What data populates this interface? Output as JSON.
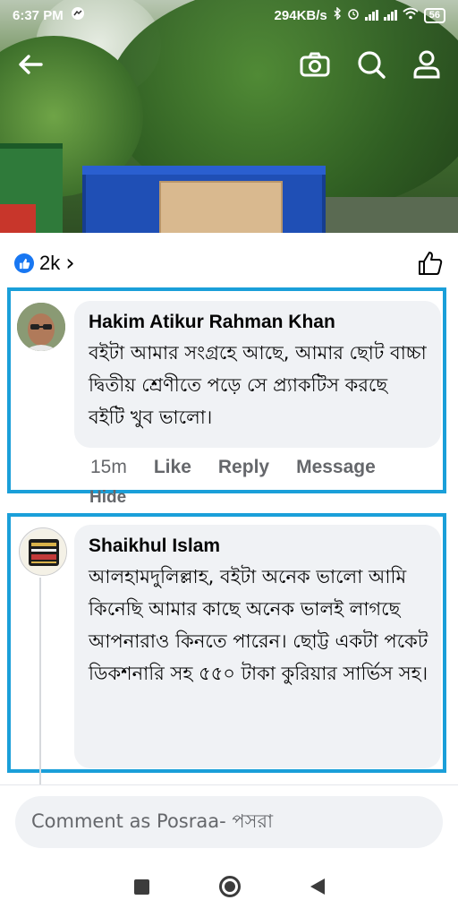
{
  "status_bar": {
    "time": "6:37 PM",
    "speed": "294KB/s",
    "battery": "56"
  },
  "toolbar": {
    "icons": [
      "back-arrow-icon",
      "camera-icon",
      "search-icon",
      "profile-icon"
    ]
  },
  "reactions": {
    "count": "2k",
    "chevron": "›"
  },
  "comments": [
    {
      "author": "Hakim Atikur Rahman Khan",
      "text": "বইটা আমার সংগ্রহে আছে, আমার ছোট বাচ্চা দ্বিতীয় শ্রেণীতে পড়ে সে প্র্যাকটিস করছে বইটি খুব ভালো।",
      "time": "15m",
      "like_label": "Like",
      "reply_label": "Reply",
      "message_label": "Message",
      "hide_label": "Hide"
    },
    {
      "author": "Shaikhul Islam",
      "text": "আলহামদুলিল্লাহ, বইটা অনেক ভালো আমি কিনেছি আমার কাছে অনেক ভালই লাগছে আপনারাও কিনতে পারেন। ছোট্ট একটা পকেট ডিকশনারি সহ ৫৫০ টাকা কুরিয়ার সার্ভিস সহ।"
    }
  ],
  "composer": {
    "placeholder": "Comment as Posraa- পসরা"
  },
  "colors": {
    "highlight": "#1a9fd9",
    "like_blue": "#1877f2",
    "bubble": "#f0f2f5",
    "secondary_text": "#65676b"
  }
}
